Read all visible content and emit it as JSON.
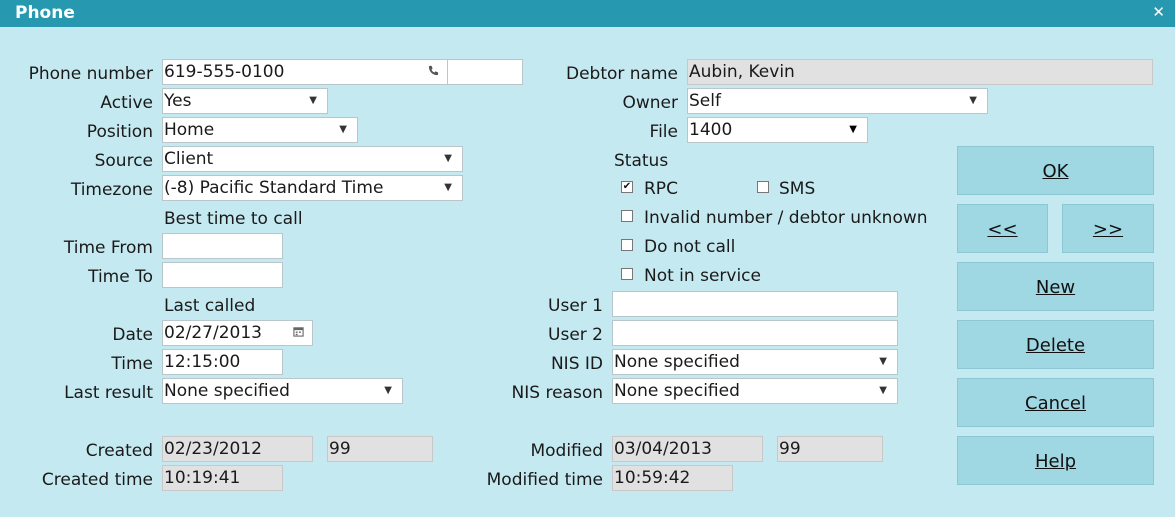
{
  "window": {
    "title": "Phone",
    "close_glyph": "✕"
  },
  "left": {
    "phone_number": {
      "label": "Phone number",
      "value": "619-555-0100",
      "ext": ""
    },
    "active": {
      "label": "Active",
      "value": "Yes"
    },
    "position": {
      "label": "Position",
      "value": "Home"
    },
    "source": {
      "label": "Source",
      "value": "Client"
    },
    "timezone": {
      "label": "Timezone",
      "value": "(-8) Pacific Standard Time"
    },
    "best_time_heading": "Best time to call",
    "time_from": {
      "label": "Time From",
      "value": ""
    },
    "time_to": {
      "label": "Time To",
      "value": ""
    },
    "last_called_heading": "Last called",
    "date": {
      "label": "Date",
      "value": "02/27/2013"
    },
    "time": {
      "label": "Time",
      "value": "12:15:00"
    },
    "last_result": {
      "label": "Last result",
      "value": "None specified"
    },
    "created": {
      "label": "Created",
      "value": "02/23/2012",
      "user": "99"
    },
    "created_time": {
      "label": "Created time",
      "value": "10:19:41"
    }
  },
  "right": {
    "debtor_name": {
      "label": "Debtor name",
      "value": "Aubin, Kevin"
    },
    "owner": {
      "label": "Owner",
      "value": "Self"
    },
    "file": {
      "label": "File",
      "value": "1400"
    },
    "status_heading": "Status",
    "status": {
      "rpc": {
        "label": "RPC",
        "checked": true
      },
      "sms": {
        "label": "SMS",
        "checked": false
      },
      "invalid": {
        "label": "Invalid number / debtor unknown",
        "checked": false
      },
      "do_not_call": {
        "label": "Do not call",
        "checked": false
      },
      "not_in_service": {
        "label": "Not in service",
        "checked": false
      }
    },
    "user1": {
      "label": "User 1",
      "value": ""
    },
    "user2": {
      "label": "User 2",
      "value": ""
    },
    "nis_id": {
      "label": "NIS ID",
      "value": "None specified"
    },
    "nis_reason": {
      "label": "NIS reason",
      "value": "None specified"
    },
    "modified": {
      "label": "Modified",
      "value": "03/04/2013",
      "user": "99"
    },
    "modified_time": {
      "label": "Modified time",
      "value": "10:59:42"
    }
  },
  "buttons": {
    "ok": "OK",
    "prev": "<<",
    "next": ">>",
    "new": "New",
    "delete": "Delete",
    "cancel": "Cancel",
    "help": "Help"
  },
  "icons": {
    "phone": "phone-icon",
    "calendar": "calendar-icon",
    "dropdown": "chevron-down-icon",
    "check_mark": "✔"
  }
}
